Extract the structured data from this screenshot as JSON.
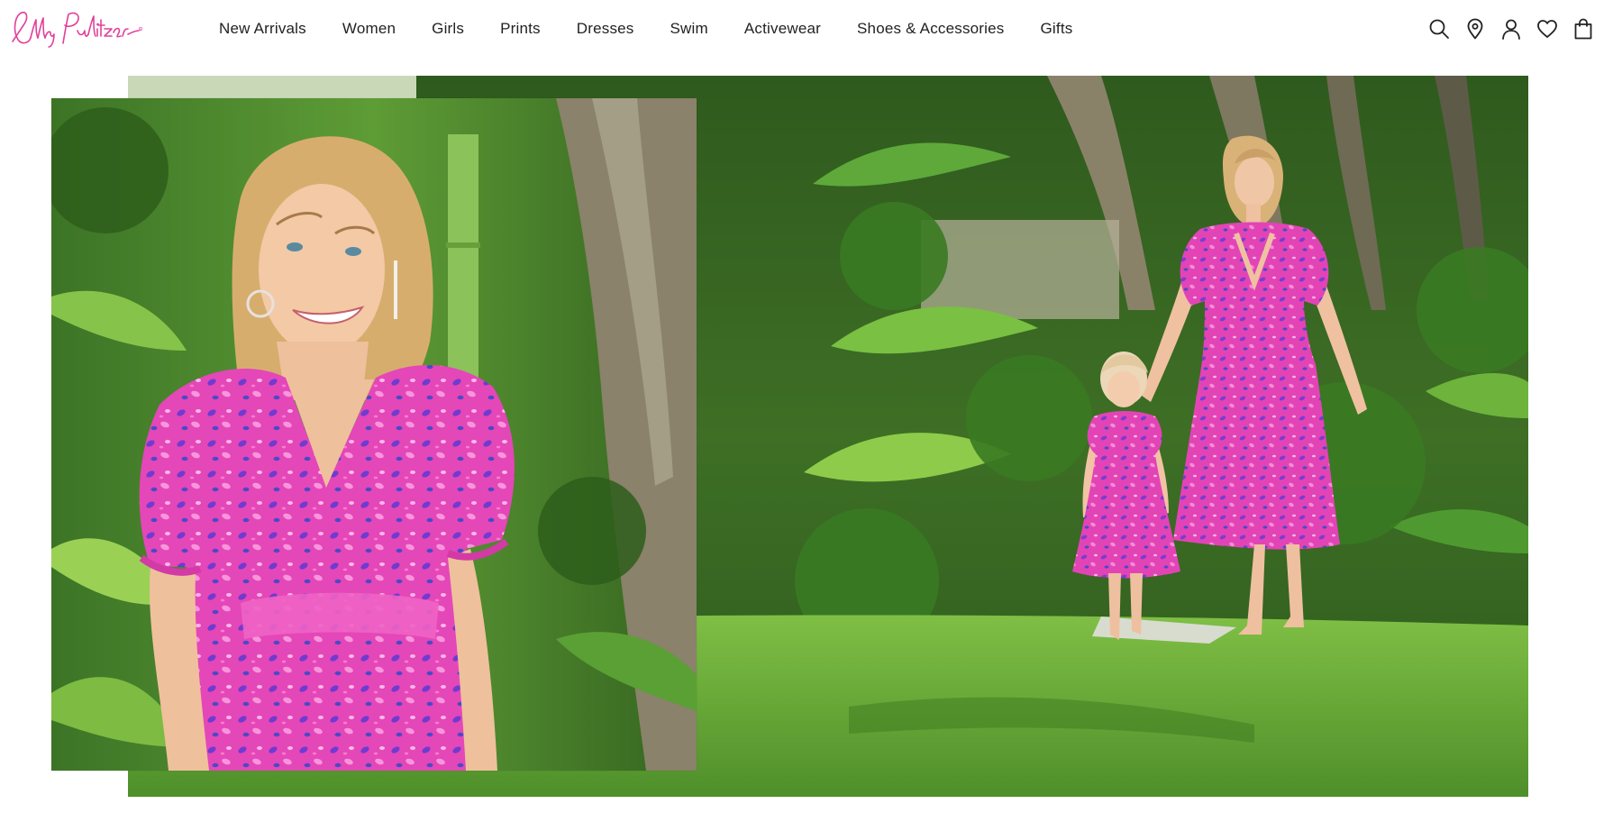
{
  "brand": {
    "name": "Lilly Pulitzer",
    "logo_color": "#e2409a"
  },
  "nav": {
    "items": [
      {
        "label": "New Arrivals"
      },
      {
        "label": "Women"
      },
      {
        "label": "Girls"
      },
      {
        "label": "Prints"
      },
      {
        "label": "Dresses"
      },
      {
        "label": "Swim"
      },
      {
        "label": "Activewear"
      },
      {
        "label": "Shoes & Accessories"
      },
      {
        "label": "Gifts"
      }
    ]
  },
  "utility": {
    "icons": [
      "search-icon",
      "store-locator-icon",
      "account-icon",
      "wishlist-icon",
      "shopping-bag-icon"
    ]
  },
  "hero": {
    "main_image": "mother-and-daughter-in-pink-print-dresses-walking-in-garden",
    "inset_image": "woman-in-pink-puff-sleeve-wrap-dress-closeup",
    "colors": {
      "dress_pink": "#e043b4",
      "foliage_green": "#3f7a2a",
      "grass_green": "#6fae3a"
    }
  }
}
